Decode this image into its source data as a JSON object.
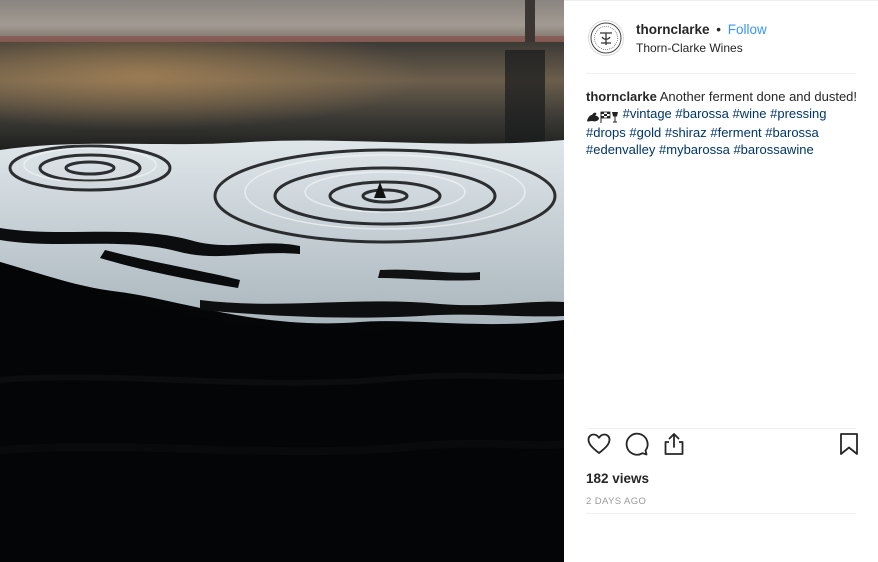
{
  "post": {
    "username": "thornclarke",
    "separator": "•",
    "follow_label": "Follow",
    "location": "Thorn-Clarke Wines",
    "caption": {
      "username": "thornclarke",
      "text": "Another ferment done and dusted!",
      "emoji_icons": [
        "flexed-biceps-icon",
        "chequered-flag-icon",
        "wine-glass-icon"
      ],
      "hashtags": [
        "#vintage",
        "#barossa",
        "#wine",
        "#pressing",
        "#drops",
        "#gold",
        "#shiraz",
        "#ferment",
        "#barossa",
        "#edenvalley",
        "#mybarossa",
        "#barossawine"
      ]
    },
    "actions": [
      "heart-icon",
      "comment-icon",
      "share-icon",
      "bookmark-icon"
    ],
    "views": "182 views",
    "time_ago": "2 DAYS AGO"
  },
  "colors": {
    "link_blue": "#3897f0",
    "hashtag_blue": "#003569",
    "text": "#262626",
    "muted": "#999999",
    "divider": "#efefef"
  }
}
